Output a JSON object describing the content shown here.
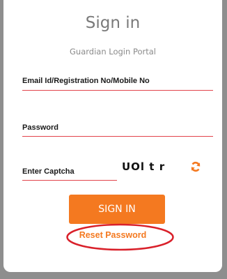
{
  "header": {
    "title": "Sign in",
    "subtitle": "Guardian Login Portal"
  },
  "form": {
    "email_label": "Email Id/Registration No/Mobile No",
    "password_label": "Password",
    "captcha_label": "Enter Captcha",
    "captcha_code": "UOl t r",
    "submit_label": "SIGN IN",
    "reset_label": "Reset Password"
  },
  "icons": {
    "refresh": "refresh-icon"
  },
  "colors": {
    "accent": "#f47920",
    "underline": "#e2434b",
    "annotation": "#d9202a",
    "background": "#8e8e8e"
  }
}
